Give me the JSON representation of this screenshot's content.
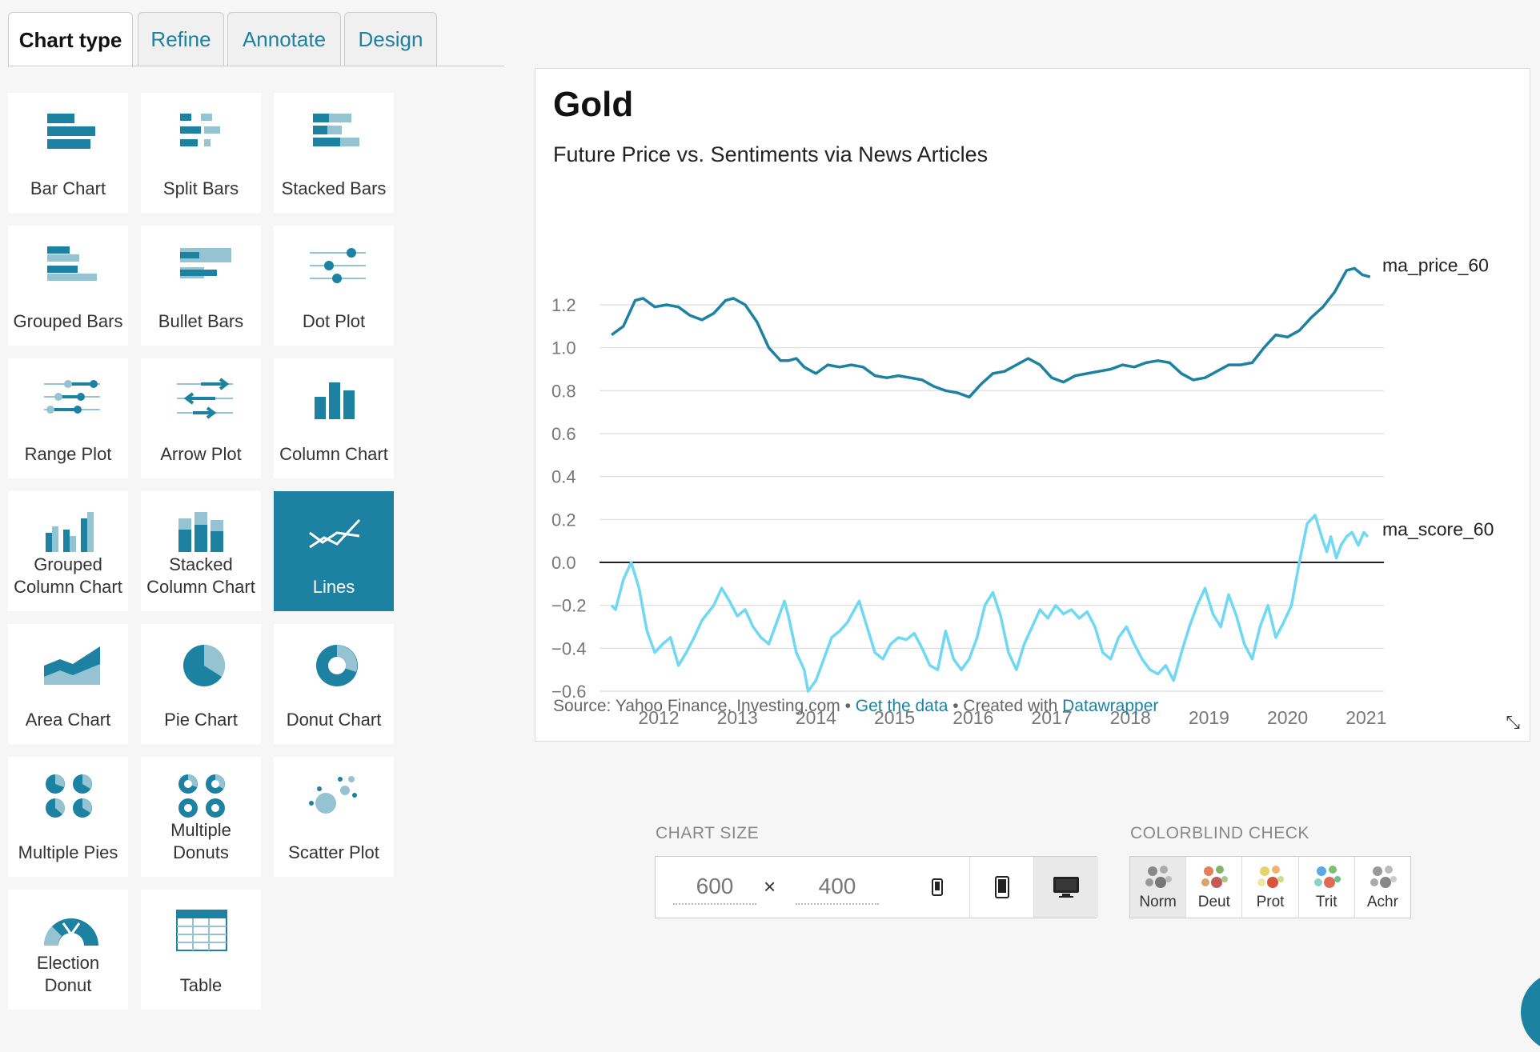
{
  "tabs": [
    {
      "label": "Chart type",
      "active": true
    },
    {
      "label": "Refine",
      "active": false
    },
    {
      "label": "Annotate",
      "active": false
    },
    {
      "label": "Design",
      "active": false
    }
  ],
  "chart_types": [
    {
      "label": "Bar Chart",
      "icon": "bar-chart-icon"
    },
    {
      "label": "Split Bars",
      "icon": "split-bars-icon"
    },
    {
      "label": "Stacked Bars",
      "icon": "stacked-bars-icon"
    },
    {
      "label": "Grouped Bars",
      "icon": "grouped-bars-icon"
    },
    {
      "label": "Bullet Bars",
      "icon": "bullet-bars-icon"
    },
    {
      "label": "Dot Plot",
      "icon": "dot-plot-icon"
    },
    {
      "label": "Range Plot",
      "icon": "range-plot-icon"
    },
    {
      "label": "Arrow Plot",
      "icon": "arrow-plot-icon"
    },
    {
      "label": "Column Chart",
      "icon": "column-chart-icon"
    },
    {
      "label": "Grouped Column Chart",
      "icon": "grouped-column-icon"
    },
    {
      "label": "Stacked Column Chart",
      "icon": "stacked-column-icon"
    },
    {
      "label": "Lines",
      "icon": "lines-icon",
      "selected": true
    },
    {
      "label": "Area Chart",
      "icon": "area-chart-icon"
    },
    {
      "label": "Pie Chart",
      "icon": "pie-chart-icon"
    },
    {
      "label": "Donut Chart",
      "icon": "donut-chart-icon"
    },
    {
      "label": "Multiple Pies",
      "icon": "multiple-pies-icon"
    },
    {
      "label": "Multiple Donuts",
      "icon": "multiple-donuts-icon"
    },
    {
      "label": "Scatter Plot",
      "icon": "scatter-plot-icon"
    },
    {
      "label": "Election Donut",
      "icon": "election-donut-icon"
    },
    {
      "label": "Table",
      "icon": "table-icon"
    }
  ],
  "preview": {
    "title": "Gold",
    "subtitle": "Future Price vs. Sentiments via News Articles",
    "footer_source": "Source: Yahoo Finance, Investing.com • ",
    "footer_link_data": "Get the data",
    "footer_created": " • Created with ",
    "footer_link_tool": "Datawrapper"
  },
  "chart_data": {
    "type": "line",
    "title": "Gold",
    "subtitle": "Future Price vs. Sentiments via News Articles",
    "xlabel": "",
    "ylabel": "",
    "xlim": [
      2011.3,
      2021.25
    ],
    "ylim": [
      -0.6,
      1.3
    ],
    "x_ticks": [
      "2012",
      "2013",
      "2014",
      "2015",
      "2016",
      "2017",
      "2018",
      "2019",
      "2020",
      "2021"
    ],
    "y_ticks": [
      "1.2",
      "1.0",
      "0.8",
      "0.6",
      "0.4",
      "0.2",
      "0.0",
      "−0.2",
      "−0.4",
      "−0.6"
    ],
    "y_tick_values": [
      1.2,
      1.0,
      0.8,
      0.6,
      0.4,
      0.2,
      0.0,
      -0.2,
      -0.4,
      -0.6
    ],
    "grid": true,
    "series": [
      {
        "name": "ma_price_60",
        "color": "#1d81a2",
        "x": [
          2011.4,
          2011.55,
          2011.7,
          2011.8,
          2011.95,
          2012.1,
          2012.25,
          2012.4,
          2012.55,
          2012.7,
          2012.85,
          2012.95,
          2013.1,
          2013.25,
          2013.4,
          2013.55,
          2013.65,
          2013.75,
          2013.85,
          2014.0,
          2014.15,
          2014.3,
          2014.45,
          2014.6,
          2014.75,
          2014.9,
          2015.05,
          2015.2,
          2015.35,
          2015.5,
          2015.65,
          2015.8,
          2015.95,
          2016.1,
          2016.25,
          2016.4,
          2016.55,
          2016.7,
          2016.85,
          2017.0,
          2017.15,
          2017.3,
          2017.45,
          2017.6,
          2017.75,
          2017.9,
          2018.05,
          2018.2,
          2018.35,
          2018.5,
          2018.65,
          2018.8,
          2018.95,
          2019.1,
          2019.25,
          2019.4,
          2019.55,
          2019.7,
          2019.85,
          2020.0,
          2020.15,
          2020.3,
          2020.45,
          2020.6,
          2020.75,
          2020.85,
          2020.95,
          2021.05
        ],
        "values": [
          1.06,
          1.1,
          1.22,
          1.23,
          1.19,
          1.2,
          1.19,
          1.15,
          1.13,
          1.16,
          1.22,
          1.23,
          1.2,
          1.12,
          1.0,
          0.94,
          0.94,
          0.95,
          0.91,
          0.88,
          0.92,
          0.91,
          0.92,
          0.91,
          0.87,
          0.86,
          0.87,
          0.86,
          0.85,
          0.82,
          0.8,
          0.79,
          0.77,
          0.83,
          0.88,
          0.89,
          0.92,
          0.95,
          0.92,
          0.86,
          0.84,
          0.87,
          0.88,
          0.89,
          0.9,
          0.92,
          0.91,
          0.93,
          0.94,
          0.93,
          0.88,
          0.85,
          0.86,
          0.89,
          0.92,
          0.92,
          0.93,
          1.0,
          1.06,
          1.05,
          1.08,
          1.14,
          1.19,
          1.26,
          1.36,
          1.37,
          1.34,
          1.33
        ]
      },
      {
        "name": "ma_score_60",
        "color": "#6fd8f2",
        "x": [
          2011.4,
          2011.45,
          2011.55,
          2011.65,
          2011.75,
          2011.85,
          2011.95,
          2012.05,
          2012.15,
          2012.25,
          2012.35,
          2012.45,
          2012.55,
          2012.7,
          2012.8,
          2012.9,
          2013.0,
          2013.1,
          2013.2,
          2013.3,
          2013.4,
          2013.5,
          2013.6,
          2013.65,
          2013.75,
          2013.85,
          2013.9,
          2014.0,
          2014.1,
          2014.2,
          2014.3,
          2014.4,
          2014.55,
          2014.65,
          2014.75,
          2014.85,
          2014.95,
          2015.05,
          2015.15,
          2015.25,
          2015.35,
          2015.45,
          2015.55,
          2015.65,
          2015.75,
          2015.85,
          2015.95,
          2016.05,
          2016.15,
          2016.25,
          2016.35,
          2016.45,
          2016.55,
          2016.65,
          2016.75,
          2016.85,
          2016.95,
          2017.05,
          2017.15,
          2017.25,
          2017.35,
          2017.45,
          2017.55,
          2017.65,
          2017.75,
          2017.85,
          2017.95,
          2018.05,
          2018.15,
          2018.25,
          2018.35,
          2018.45,
          2018.55,
          2018.65,
          2018.75,
          2018.85,
          2018.95,
          2019.05,
          2019.15,
          2019.25,
          2019.35,
          2019.45,
          2019.55,
          2019.65,
          2019.75,
          2019.85,
          2019.95,
          2020.05,
          2020.15,
          2020.25,
          2020.35,
          2020.45,
          2020.5,
          2020.55,
          2020.62,
          2020.68,
          2020.75,
          2020.82,
          2020.9,
          2020.97,
          2021.02
        ],
        "values": [
          -0.2,
          -0.22,
          -0.08,
          0.0,
          -0.12,
          -0.32,
          -0.42,
          -0.38,
          -0.35,
          -0.48,
          -0.42,
          -0.35,
          -0.27,
          -0.2,
          -0.12,
          -0.18,
          -0.25,
          -0.22,
          -0.3,
          -0.35,
          -0.38,
          -0.28,
          -0.18,
          -0.25,
          -0.42,
          -0.5,
          -0.6,
          -0.55,
          -0.45,
          -0.35,
          -0.32,
          -0.28,
          -0.18,
          -0.3,
          -0.42,
          -0.45,
          -0.38,
          -0.35,
          -0.36,
          -0.33,
          -0.4,
          -0.48,
          -0.5,
          -0.32,
          -0.45,
          -0.5,
          -0.45,
          -0.35,
          -0.2,
          -0.14,
          -0.25,
          -0.42,
          -0.5,
          -0.38,
          -0.3,
          -0.22,
          -0.26,
          -0.2,
          -0.24,
          -0.22,
          -0.26,
          -0.23,
          -0.3,
          -0.42,
          -0.45,
          -0.35,
          -0.3,
          -0.38,
          -0.45,
          -0.5,
          -0.52,
          -0.48,
          -0.55,
          -0.42,
          -0.3,
          -0.2,
          -0.12,
          -0.24,
          -0.3,
          -0.15,
          -0.25,
          -0.38,
          -0.45,
          -0.3,
          -0.2,
          -0.35,
          -0.28,
          -0.2,
          -0.0,
          0.18,
          0.22,
          0.1,
          0.05,
          0.12,
          0.02,
          0.08,
          0.12,
          0.14,
          0.08,
          0.14,
          0.12
        ]
      }
    ]
  },
  "size_controls": {
    "section_label": "CHART SIZE",
    "width_value": "600",
    "height_value": "400",
    "times_symbol": "×",
    "devices": [
      "phone-small-icon",
      "phone-icon",
      "desktop-icon"
    ]
  },
  "colorblind": {
    "section_label": "COLORBLIND CHECK",
    "modes": [
      {
        "label": "Norm",
        "colors": [
          "#888888",
          "#aaaaaa",
          "#999999",
          "#777777",
          "#bbbbbb"
        ]
      },
      {
        "label": "Deut",
        "colors": [
          "#e67e5a",
          "#82b366",
          "#d9a46a",
          "#c25a5a",
          "#a3c98a"
        ]
      },
      {
        "label": "Prot",
        "colors": [
          "#e8d36a",
          "#f2b06b",
          "#f0e7a0",
          "#d9533b",
          "#c6e08f"
        ]
      },
      {
        "label": "Trit",
        "colors": [
          "#5aa9e6",
          "#7bc36a",
          "#8ed1c6",
          "#e06a5a",
          "#6abf8f"
        ]
      },
      {
        "label": "Achr",
        "colors": [
          "#999999",
          "#bbbbbb",
          "#aaaaaa",
          "#888888",
          "#cccccc"
        ]
      }
    ]
  },
  "colors": {
    "accent": "#1d81a2",
    "accent_light": "#95c3d2",
    "selected_tile": "#1d81a2"
  }
}
